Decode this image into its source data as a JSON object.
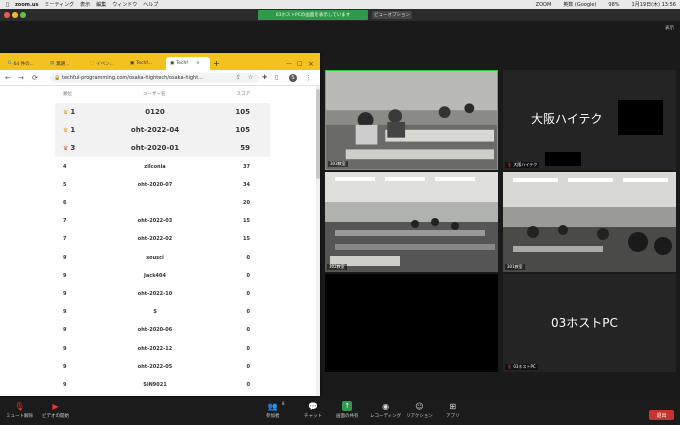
{
  "menubar": {
    "app": "zoom.us",
    "items": [
      "ミーティング",
      "表示",
      "編集",
      "ウィンドウ",
      "ヘルプ"
    ],
    "right": [
      "ZOOM",
      "英数 (Google)",
      "98%",
      "1月19日(木) 13:56"
    ]
  },
  "share_banner": "03ホストPCの画面を表示しています",
  "view_options": "ビューオプション",
  "view_label": "表示",
  "browser": {
    "tabs": [
      "64 件の...",
      "無題...",
      "イベン...",
      "Techf...",
      "Techf"
    ],
    "url": "techful-programming.com/osaka-hightech/osaka-hight...",
    "profile_initial": "S"
  },
  "ranking": {
    "headers": [
      "順位",
      "ユーザー名",
      "スコア"
    ],
    "rows": [
      {
        "rank": "1",
        "name": "0120",
        "score": "105",
        "medal": "gold"
      },
      {
        "rank": "1",
        "name": "oht-2022-04",
        "score": "105",
        "medal": "gold"
      },
      {
        "rank": "3",
        "name": "oht-2020-01",
        "score": "59",
        "medal": "bronze"
      },
      {
        "rank": "4",
        "name": "zilconia",
        "score": "37",
        "medal": ""
      },
      {
        "rank": "5",
        "name": "oht-2020-07",
        "score": "34",
        "medal": ""
      },
      {
        "rank": "6",
        "name": "",
        "score": "20",
        "medal": ""
      },
      {
        "rank": "7",
        "name": "oht-2022-03",
        "score": "15",
        "medal": ""
      },
      {
        "rank": "7",
        "name": "oht-2022-02",
        "score": "15",
        "medal": ""
      },
      {
        "rank": "9",
        "name": "sousci",
        "score": "0",
        "medal": ""
      },
      {
        "rank": "9",
        "name": "Jack404",
        "score": "0",
        "medal": ""
      },
      {
        "rank": "9",
        "name": "oht-2022-10",
        "score": "0",
        "medal": ""
      },
      {
        "rank": "9",
        "name": "S",
        "score": "0",
        "medal": ""
      },
      {
        "rank": "9",
        "name": "oht-2020-06",
        "score": "0",
        "medal": ""
      },
      {
        "rank": "9",
        "name": "oht-2022-12",
        "score": "0",
        "medal": ""
      },
      {
        "rank": "9",
        "name": "oht-2022-05",
        "score": "0",
        "medal": ""
      },
      {
        "rank": "9",
        "name": "SiN9021",
        "score": "0",
        "medal": ""
      }
    ]
  },
  "participants": {
    "room303": "303教室",
    "osaka": "大阪ハイテク",
    "osaka_label": "大阪ハイテク",
    "room302": "302教室",
    "room301": "301教室",
    "host": "03ホストPC",
    "host_label": "03ホストPC"
  },
  "toolbar": {
    "mute": "ミュート解除",
    "video": "ビデオの開始",
    "participants": "参加者",
    "participants_count": "8",
    "chat": "チャット",
    "share": "画面の共有",
    "record": "レコーディング",
    "reactions": "リアクション",
    "apps": "アプリ",
    "end": "退出"
  },
  "colors": {
    "accent_green": "#2e9a4a",
    "tab_yellow": "#f4c21f",
    "end_red": "#c8322f"
  }
}
